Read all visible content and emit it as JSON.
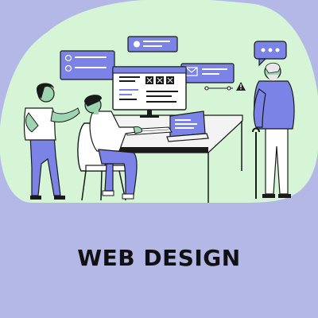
{
  "title": "WEB DESIGN",
  "colors": {
    "background": "#b4b8e6",
    "blob": "#d5f5d6",
    "accent": "#7b83e6",
    "ink": "#1a1a1a",
    "warning": "#222222"
  },
  "icons": {
    "chat": "speech-bubble-icon",
    "warning": "warning-icon",
    "mail": "envelope-icon",
    "check": "check-icon"
  }
}
